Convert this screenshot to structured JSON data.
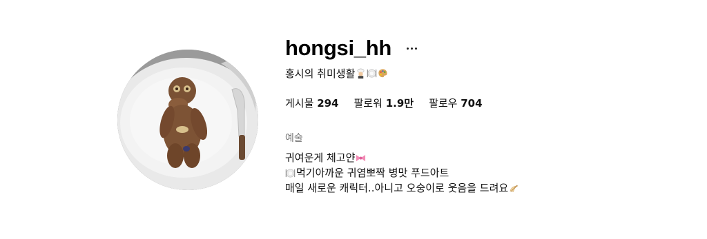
{
  "profile": {
    "username": "hongsi_hh",
    "full_name": "홍시의 취미생활",
    "posts_label": "게시물",
    "posts_count": "294",
    "followers_label": "팔로워",
    "followers_count": "1.9만",
    "following_label": "팔로우",
    "following_count": "704",
    "category": "예술",
    "bio_line1": "귀여운게 체고얀",
    "bio_line2": "먹기아까운 귀염뽀짝 병맛 푸드아트",
    "bio_line3": "매일 새로운 캐릭터..아니고 오숭이로 웃음을 드려요"
  },
  "icons": {
    "more": "more-options-icon",
    "chef": "chef-emoji-icon",
    "plate": "plate-cutlery-emoji-icon",
    "palette": "palette-emoji-icon",
    "ribbon": "ribbon-emoji-icon",
    "bow": "bow-pointing-emoji-icon"
  }
}
